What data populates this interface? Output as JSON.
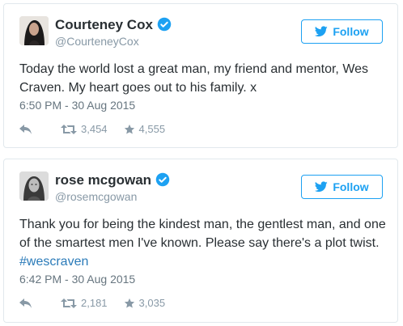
{
  "tweets": [
    {
      "name": "Courteney Cox",
      "handle": "@CourteneyCox",
      "follow_label": "Follow",
      "text": "Today the world lost a great man, my friend and mentor, Wes Craven. My heart goes out to his family. x",
      "hashtag": "",
      "timestamp": "6:50 PM - 30 Aug 2015",
      "retweets": "3,454",
      "favorites": "4,555"
    },
    {
      "name": "rose mcgowan",
      "handle": "@rosemcgowan",
      "follow_label": "Follow",
      "text": "Thank you for being the kindest man, the gentlest man, and one of the smartest men I've known. Please say there's a plot twist. ",
      "hashtag": "#wescraven",
      "timestamp": "6:42 PM - 30 Aug 2015",
      "retweets": "2,181",
      "favorites": "3,035"
    }
  ],
  "icons": {
    "verified": "verified-badge-icon",
    "bird": "twitter-bird-icon",
    "reply": "reply-arrow-icon",
    "retweet": "retweet-icon",
    "favorite": "star-icon"
  },
  "colors": {
    "accent": "#1da1f2",
    "hashtag": "#2b7bb9",
    "muted": "#8899a6",
    "text": "#292f33"
  }
}
